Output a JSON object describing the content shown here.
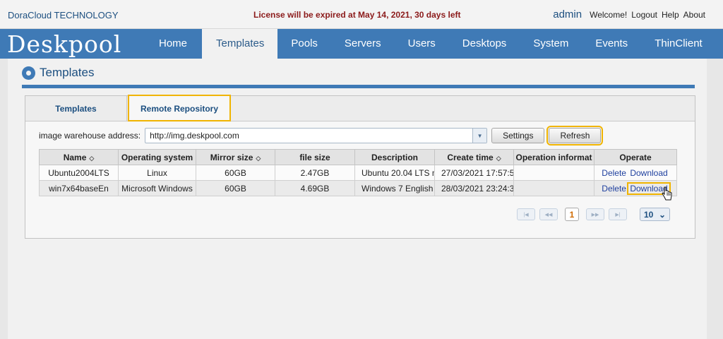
{
  "topbar": {
    "company": "DoraCloud TECHNOLOGY",
    "license_notice": "License will be expired at May 14, 2021, 30 days left",
    "username": "admin",
    "welcome": "Welcome!",
    "logout": "Logout",
    "help": "Help",
    "about": "About"
  },
  "brand": {
    "logo_text": "Deskpool"
  },
  "nav": {
    "items": [
      {
        "label": "Home"
      },
      {
        "label": "Templates"
      },
      {
        "label": "Pools"
      },
      {
        "label": "Servers"
      },
      {
        "label": "Users"
      },
      {
        "label": "Desktops"
      },
      {
        "label": "System"
      },
      {
        "label": "Events"
      },
      {
        "label": "ThinClient"
      }
    ],
    "active": "Templates"
  },
  "page": {
    "title": "Templates",
    "icon": "film-reel-icon"
  },
  "tabs": {
    "templates": "Templates",
    "remote_repository": "Remote Repository",
    "active": "Remote Repository"
  },
  "address": {
    "label": "image warehouse address:",
    "value": "http://img.deskpool.com",
    "settings_label": "Settings",
    "refresh_label": "Refresh"
  },
  "table": {
    "headers": [
      "Name",
      "Operating system",
      "Mirror size",
      "file size",
      "Description",
      "Create time",
      "Operation informat",
      "Operate"
    ],
    "sortable": [
      true,
      false,
      true,
      false,
      false,
      true,
      false,
      false
    ],
    "rows": [
      {
        "name": "Ubuntu2004LTS",
        "os": "Linux",
        "mirror_size": "60GB",
        "file_size": "2.47GB",
        "description": "Ubuntu 20.04 LTS m",
        "create_time": "27/03/2021 17:57:5€",
        "op_info": "",
        "delete": "Delete",
        "download": "Download"
      },
      {
        "name": "win7x64baseEn",
        "os": "Microsoft Windows",
        "mirror_size": "60GB",
        "file_size": "4.69GB",
        "description": "Windows 7 English",
        "create_time": "28/03/2021 23:24:3€",
        "op_info": "",
        "delete": "Delete",
        "download": "Download"
      }
    ]
  },
  "pager": {
    "current_page": "1",
    "page_size": "10"
  },
  "colors": {
    "nav_blue": "#3f7ab6",
    "highlight": "#f0b400",
    "license_red": "#8b1a1a"
  }
}
